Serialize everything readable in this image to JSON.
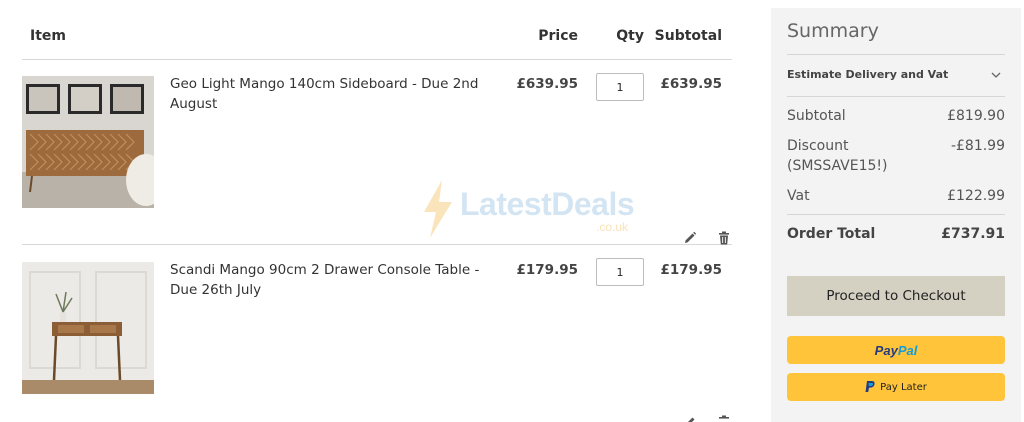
{
  "cart": {
    "headers": {
      "item": "Item",
      "price": "Price",
      "qty": "Qty",
      "subtotal": "Subtotal"
    },
    "items": [
      {
        "name": "Geo Light Mango 140cm Sideboard - Due 2nd August",
        "price": "£639.95",
        "qty": "1",
        "subtotal": "£639.95"
      },
      {
        "name": "Scandi Mango 90cm 2 Drawer Console Table - Due 26th July",
        "price": "£179.95",
        "qty": "1",
        "subtotal": "£179.95"
      }
    ]
  },
  "watermark": {
    "brand": "LatestDeals",
    "domain": ".co.uk"
  },
  "summary": {
    "title": "Summary",
    "estimate_label": "Estimate Delivery and Vat",
    "subtotal_label": "Subtotal",
    "subtotal_value": "£819.90",
    "discount_label": "Discount (SMSSAVE15!)",
    "discount_value": "-£81.99",
    "vat_label": "Vat",
    "vat_value": "£122.99",
    "total_label": "Order Total",
    "total_value": "£737.91",
    "checkout_label": "Proceed to Checkout",
    "paypal_part1": "Pay",
    "paypal_part2": "Pal",
    "paylater_label": "Pay Later"
  },
  "colors": {
    "summary_bg": "#f3f3f3",
    "checkout_bg": "#d4d0c2",
    "paypal_yellow": "#ffc439",
    "paypal_dark_blue": "#253b80",
    "paypal_light_blue": "#179bd7"
  }
}
